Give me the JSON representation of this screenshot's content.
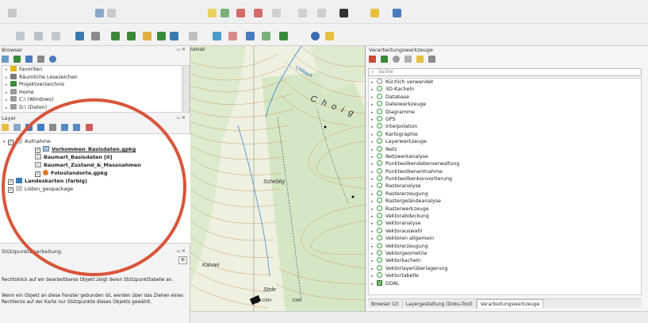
{
  "browser": {
    "title": "Browser",
    "items": [
      {
        "label": "Favoriten",
        "color": "#e8b400"
      },
      {
        "label": "Räumliche Lesezeichen",
        "color": "#7a7a7a"
      },
      {
        "label": "Projektverzeichnis",
        "color": "#3a8a3a"
      },
      {
        "label": "Home",
        "color": "#9a9a9a"
      },
      {
        "label": "C:\\ (Windows)",
        "color": "#9a9a9a"
      },
      {
        "label": "D:\\ (Daten)",
        "color": "#9a9a9a"
      }
    ]
  },
  "layers": {
    "title": "Layer",
    "group_aufnahme": "Aufnahme",
    "vorkommen": "Vorkommen_Basisdaten.gpkg",
    "baumart_basis": "Baumart_Basisdaten [0]",
    "baumart_zustand": "Baumart_Zustand_&_Massnahmen",
    "fotostandorte": "Fotostandorte.gpkg",
    "landeskarten": "Landeskarten (farbig)",
    "listen": "Listen_geopackage"
  },
  "vertex": {
    "title": "Stützpunktbearbeitung",
    "hint1": "Rechtsklick auf ein bearbeitbares Objekt zeigt deren Stützpunkttabelle an.",
    "hint2": "Wenn ein Objekt an diese Fenster gebunden ist, werden über das Ziehen eines Rechtecks auf der Karte nur Stützpunkte dieses Objekts gewählt."
  },
  "map": {
    "label_chilbach": "Chilbach",
    "label_choige": "C h o i g",
    "label_scheblig": "Scheblig",
    "label_kalvari": "Kalvari",
    "label_stole": "Stole",
    "label_lutmatt": "lutmatt",
    "label_1084": "1084",
    "label_1086": "1086"
  },
  "processing": {
    "title": "Verarbeitungswerkzeuge",
    "search_placeholder": "Suche",
    "items": [
      "Kürzlich verwendet",
      "3D-Kacheln",
      "Database",
      "Dateiwerkzeuge",
      "Diagramme",
      "GPS",
      "Interpolation",
      "Kartographie",
      "Layerwerkzeuge",
      "Netz",
      "Netzwerkanalyse",
      "Punktwolkendatenverwaltung",
      "Punktwolkenentnahme",
      "Punktwolkenkonvertierung",
      "Rasteranalyse",
      "Rastererzeugung",
      "Rastergeländeanalyse",
      "Rasterwerkzeuge",
      "Vektorabdeckung",
      "Vektoranalyse",
      "Vektorauswahl",
      "Vektoren allgemein",
      "Vektorerzeugung",
      "Vektorgeometrie",
      "Vektorkacheln",
      "Vektorlayerüberlagerung",
      "Vektortabelle",
      "GDAL"
    ]
  },
  "tabs": {
    "browser": "Browser (2)",
    "layout": "Layergestaltung (Doku-Tool)",
    "processing": "Verarbeitungswerkzeuge"
  },
  "colors": {
    "annotation": "#d8553a",
    "processing_icon": "#3a9a3a"
  }
}
